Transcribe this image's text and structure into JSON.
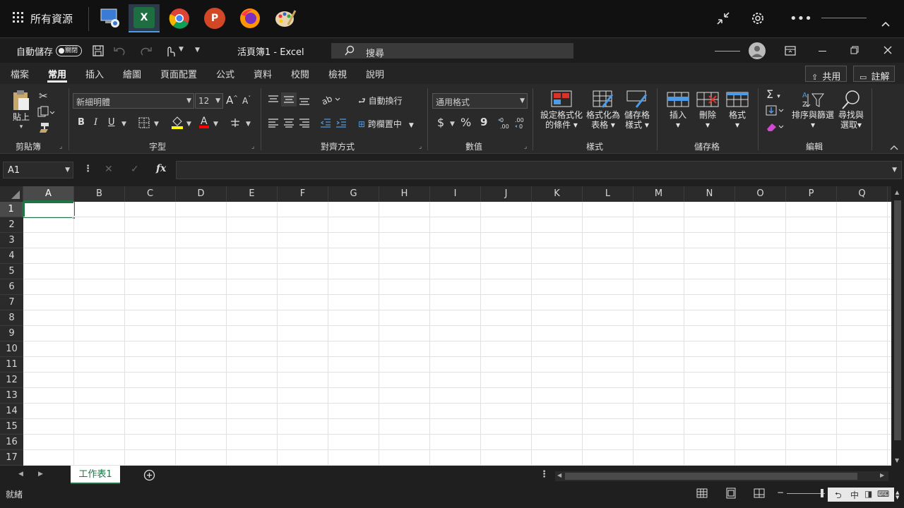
{
  "taskbar": {
    "apps_label": "所有資源",
    "apps": [
      "remote-desktop",
      "excel",
      "chrome",
      "powerpoint",
      "firefox",
      "paint"
    ],
    "excel_letter": "X",
    "ppt_letter": "P"
  },
  "titlebar": {
    "autosave_label": "自動儲存",
    "autosave_state": "關閉",
    "doc_title": "活頁簿1 - Excel",
    "search_placeholder": "搜尋"
  },
  "tabs": [
    "檔案",
    "常用",
    "插入",
    "繪圖",
    "頁面配置",
    "公式",
    "資料",
    "校閱",
    "檢視",
    "說明"
  ],
  "share_label": "共用",
  "comments_label": "註解",
  "ribbon": {
    "clipboard": {
      "paste": "貼上",
      "label": "剪貼簿"
    },
    "font": {
      "name": "新細明體",
      "size": "12",
      "label": "字型",
      "bold": "B",
      "italic": "I",
      "underline": "U",
      "grow": "A",
      "shrink": "A"
    },
    "align": {
      "wrap": "自動換行",
      "merge": "跨欄置中",
      "label": "對齊方式"
    },
    "number": {
      "format": "通用格式",
      "label": "數值",
      "currency": "$",
      "percent": "%",
      "comma": "9"
    },
    "styles": {
      "cond1": "設定格式化",
      "cond2": "的條件",
      "table1": "格式化為",
      "table2": "表格",
      "cell1": "儲存格",
      "cell2": "樣式",
      "label": "樣式"
    },
    "cells": {
      "insert": "插入",
      "delete": "刪除",
      "format": "格式",
      "label": "儲存格"
    },
    "editing": {
      "sort1": "排序與篩選",
      "find1": "尋找與",
      "find2": "選取",
      "label": "編輯",
      "sigma": "Σ"
    }
  },
  "formula": {
    "namebox": "A1",
    "fx": "fx"
  },
  "columns": [
    "A",
    "B",
    "C",
    "D",
    "E",
    "F",
    "G",
    "H",
    "I",
    "J",
    "K",
    "L",
    "M",
    "N",
    "O",
    "P",
    "Q"
  ],
  "rows": [
    "1",
    "2",
    "3",
    "4",
    "5",
    "6",
    "7",
    "8",
    "9",
    "10",
    "11",
    "12",
    "13",
    "14",
    "15",
    "16",
    "17"
  ],
  "sheet_tab": "工作表1",
  "status": {
    "ready": "就緒"
  },
  "accent": "#217346"
}
